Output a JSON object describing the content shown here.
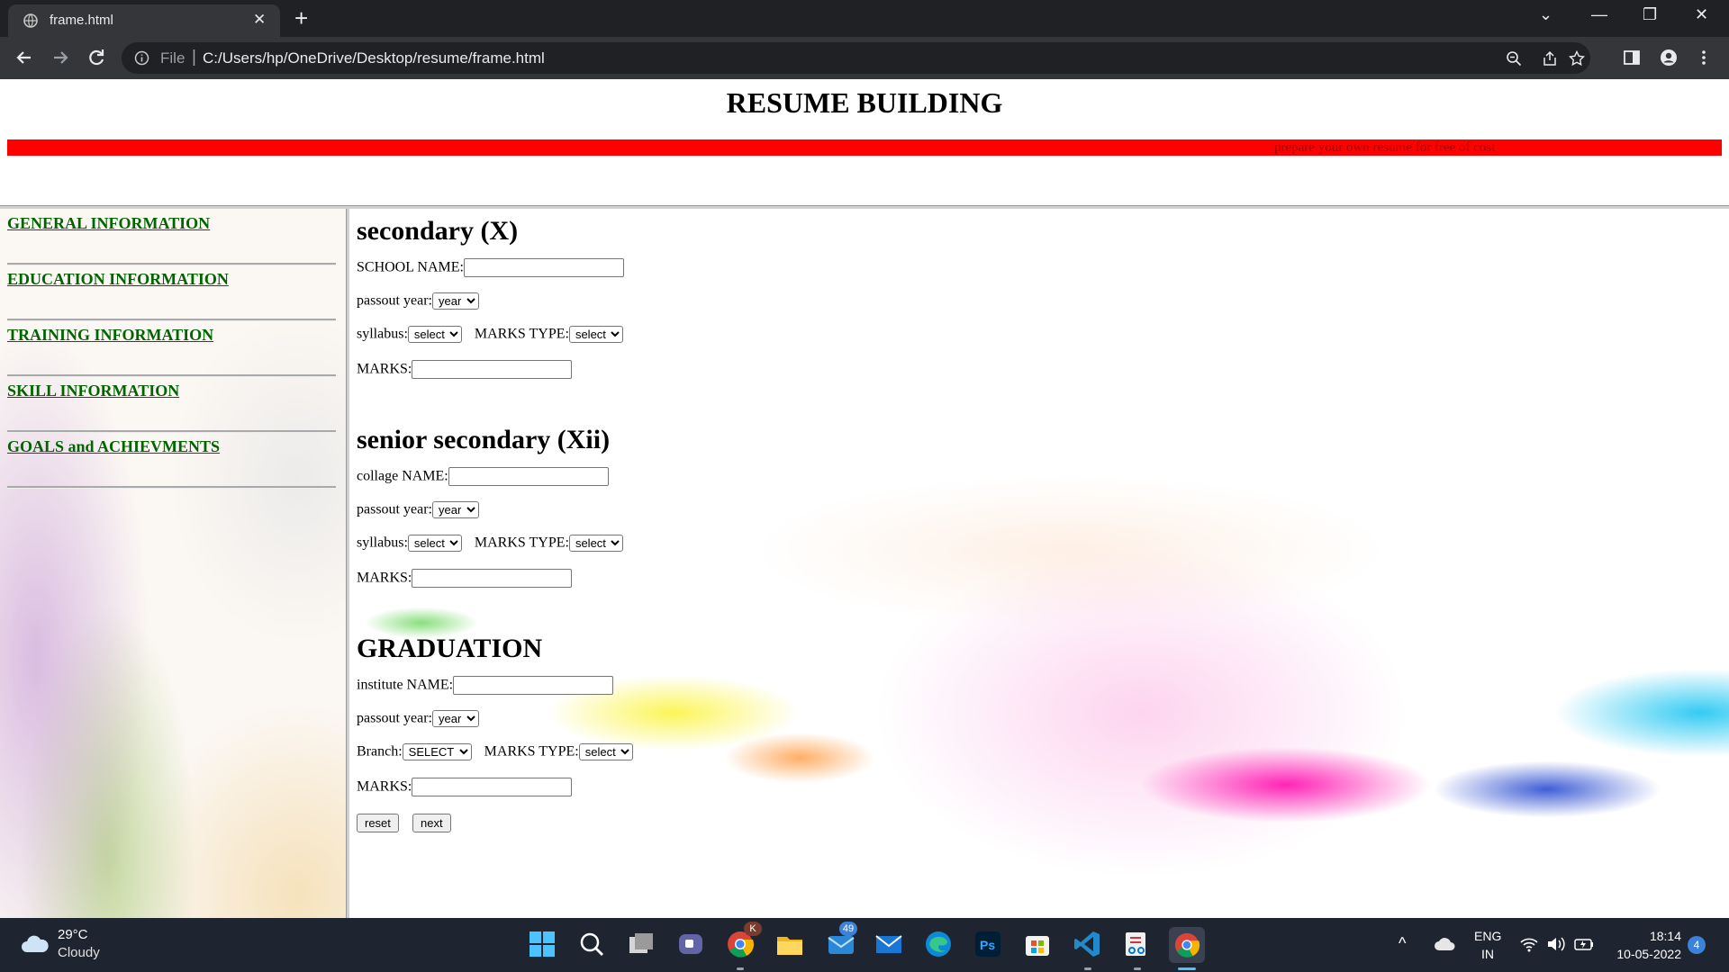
{
  "browser": {
    "tab_title": "frame.html",
    "url_scheme": "File",
    "url": "C:/Users/hp/OneDrive/Desktop/resume/frame.html"
  },
  "header": {
    "title": "RESUME BUILDING",
    "marquee_text": "prepare your own resume for free of cost",
    "marquee_bg_color": "#ff0000"
  },
  "sidebar": {
    "link_color": "#006400",
    "items": [
      {
        "label": "GENERAL INFORMATION"
      },
      {
        "label": "EDUCATION INFORMATION"
      },
      {
        "label": "TRAINING INFORMATION"
      },
      {
        "label": "SKILL INFORMATION"
      },
      {
        "label": "GOALS and ACHIEVMENTS"
      }
    ]
  },
  "form": {
    "secondary": {
      "heading": "secondary (X)",
      "school_label": "SCHOOL NAME:",
      "school_value": "",
      "passout_label": "passout year:",
      "passout_selected": "year",
      "syllabus_label": "syllabus:",
      "syllabus_selected": "select",
      "marks_type_label": "MARKS TYPE:",
      "marks_type_selected": "select",
      "marks_label": "MARKS:",
      "marks_value": ""
    },
    "senior_secondary": {
      "heading": "senior secondary (Xii)",
      "college_label": "collage NAME:",
      "college_value": "",
      "passout_label": "passout year:",
      "passout_selected": "year",
      "syllabus_label": "syllabus:",
      "syllabus_selected": "select",
      "marks_type_label": "MARKS TYPE:",
      "marks_type_selected": "select",
      "marks_label": "MARKS:",
      "marks_value": ""
    },
    "graduation": {
      "heading": "GRADUATION",
      "institute_label": "institute NAME:",
      "institute_value": "",
      "passout_label": "passout year:",
      "passout_selected": "year",
      "branch_label": "Branch:",
      "branch_selected": "SELECT",
      "marks_type_label": "MARKS TYPE:",
      "marks_type_selected": "select",
      "marks_label": "MARKS:",
      "marks_value": ""
    },
    "reset_label": "reset",
    "next_label": "next"
  },
  "taskbar": {
    "weather_temp": "29°C",
    "weather_condition": "Cloudy",
    "apps": [
      "windows-start",
      "search",
      "task-view",
      "teams-chat",
      "chrome-profile",
      "file-explorer",
      "mail-badge",
      "mail",
      "edge",
      "photoshop",
      "microsoft-store",
      "vscode",
      "snipping-tool",
      "chrome"
    ],
    "mail_badge_count": "49",
    "chrome_profile_badge": "K",
    "language": "ENG",
    "region": "IN",
    "time": "18:14",
    "date": "10-05-2022",
    "notification_count": "4"
  }
}
